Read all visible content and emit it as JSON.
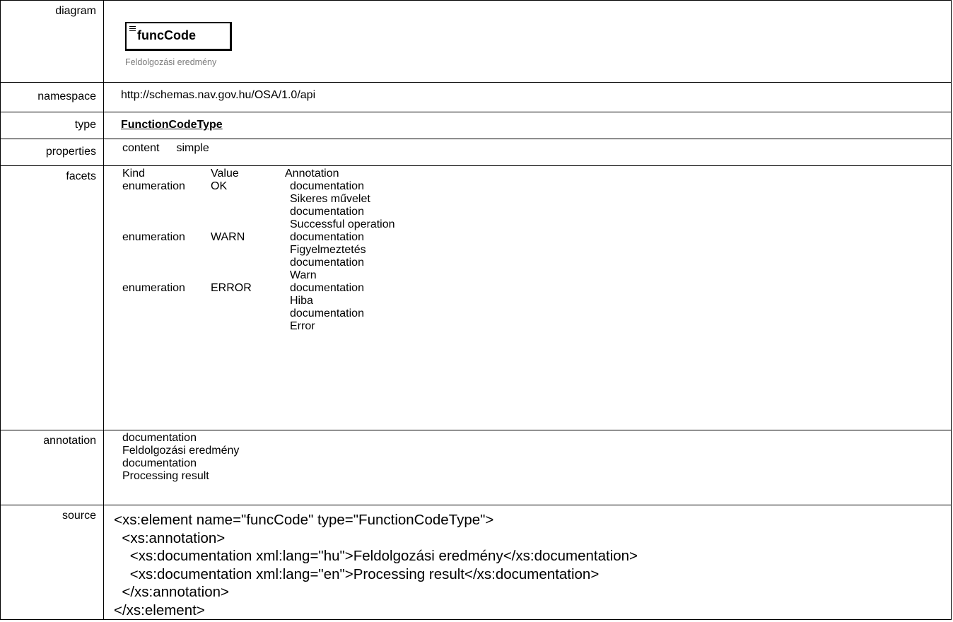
{
  "rows": {
    "diagram": {
      "label": "diagram",
      "element_name": "funcCode",
      "element_caption": "Feldolgozási eredmény",
      "icon": "element-content-icon"
    },
    "namespace": {
      "label": "namespace",
      "value": "http://schemas.nav.gov.hu/OSA/1.0/api"
    },
    "type": {
      "label": "type",
      "value": "FunctionCodeType"
    },
    "properties": {
      "label": "properties",
      "key": "content",
      "value": "simple"
    },
    "facets": {
      "label": "facets",
      "headers": [
        "Kind",
        "Value",
        "Annotation"
      ],
      "items": [
        {
          "kind": "enumeration",
          "value": "OK",
          "annotation": [
            "documentation",
            "Sikeres művelet",
            "documentation",
            "Successful operation"
          ]
        },
        {
          "kind": "enumeration",
          "value": "WARN",
          "annotation": [
            "documentation",
            "Figyelmeztetés",
            "documentation",
            "Warn"
          ]
        },
        {
          "kind": "enumeration",
          "value": "ERROR",
          "annotation": [
            "documentation",
            "Hiba",
            "documentation",
            "Error"
          ]
        }
      ]
    },
    "annotation": {
      "label": "annotation",
      "lines": [
        "documentation",
        "Feldolgozási eredmény",
        "documentation",
        "Processing result"
      ]
    },
    "source": {
      "label": "source",
      "lines": [
        "<xs:element name=\"funcCode\" type=\"FunctionCodeType\">",
        "  <xs:annotation>",
        "    <xs:documentation xml:lang=\"hu\">Feldolgozási eredmény</xs:documentation>",
        "    <xs:documentation xml:lang=\"en\">Processing result</xs:documentation>",
        "  </xs:annotation>",
        "</xs:element>"
      ]
    }
  }
}
